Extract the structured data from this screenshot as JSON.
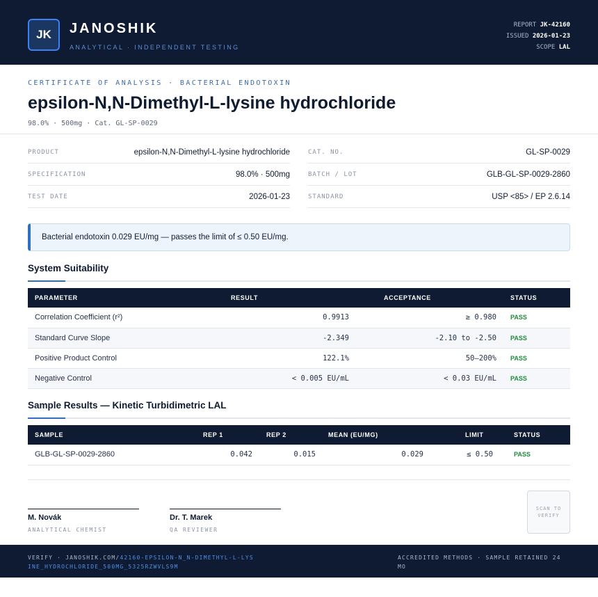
{
  "header": {
    "logo_initials": "JK",
    "brand": "JANOSHIK",
    "tagline": "ANALYTICAL · INDEPENDENT TESTING",
    "report_label": "REPORT",
    "report_value": "JK-42160",
    "issued_label": "ISSUED",
    "issued_value": "2026-01-23",
    "scope_label": "SCOPE",
    "scope_value": "LAL"
  },
  "document": {
    "kicker": "CERTIFICATE OF ANALYSIS · BACTERIAL ENDOTOXIN",
    "title": "epsilon-N,N-Dimethyl-L-lysine hydrochloride",
    "subtitle": "98.0% · 500mg  ·  Cat. GL-SP-0029"
  },
  "info": {
    "product_label": "PRODUCT",
    "product_value": "epsilon-N,N-Dimethyl-L-lysine hydrochloride",
    "spec_label": "SPECIFICATION",
    "spec_value": "98.0% · 500mg",
    "date_label": "TEST DATE",
    "date_value": "2026-01-23",
    "cat_label": "CAT. NO.",
    "cat_value": "GL-SP-0029",
    "batch_label": "BATCH / LOT",
    "batch_value": "GLB-GL-SP-0029-2860",
    "standard_label": "STANDARD",
    "standard_value": "USP <85> / EP 2.6.14"
  },
  "notice": "Bacterial endotoxin 0.029 EU/mg — passes the limit of ≤ 0.50 EU/mg.",
  "suitability": {
    "title": "System Suitability",
    "headers": [
      "PARAMETER",
      "RESULT",
      "ACCEPTANCE",
      "STATUS"
    ],
    "rows": [
      {
        "parameter": "Correlation Coefficient (r²)",
        "result": "0.9913",
        "acceptance": "≥ 0.980",
        "status": "PASS"
      },
      {
        "parameter": "Standard Curve Slope",
        "result": "-2.349",
        "acceptance": "-2.10 to -2.50",
        "status": "PASS"
      },
      {
        "parameter": "Positive Product Control",
        "result": "122.1%",
        "acceptance": "50–200%",
        "status": "PASS"
      },
      {
        "parameter": "Negative Control",
        "result": "< 0.005 EU/mL",
        "acceptance": "< 0.03 EU/mL",
        "status": "PASS"
      }
    ]
  },
  "samples": {
    "title": "Sample Results — Kinetic Turbidimetric LAL",
    "headers": [
      "SAMPLE",
      "REP 1",
      "REP 2",
      "MEAN (EU/MG)",
      "LIMIT",
      "STATUS"
    ],
    "rows": [
      {
        "sample": "GLB-GL-SP-0029-2860",
        "rep1": "0.042",
        "rep2": "0.015",
        "mean": "0.029",
        "limit": "≤ 0.50",
        "status": "PASS"
      }
    ]
  },
  "signatures": [
    {
      "name": "M. Novák",
      "role": "ANALYTICAL CHEMIST"
    },
    {
      "name": "Dr. T. Marek",
      "role": "QA REVIEWER"
    }
  ],
  "qr_text": "SCAN TO VERIFY",
  "footer": {
    "verify_prefix": "VERIFY · JANOSHIK.COM/",
    "verify_link": "42160-EPSILON-N_N-DIMETHYL-L-LYSINE_HYDROCHLORIDE_500MG_5325RZWVLS9M",
    "right": "ACCREDITED METHODS · SAMPLE RETAINED 24 MO"
  },
  "colors": {
    "navy": "#0f1b33",
    "accent_blue": "#2f6fbf",
    "pass_green": "#1f8a3a"
  }
}
